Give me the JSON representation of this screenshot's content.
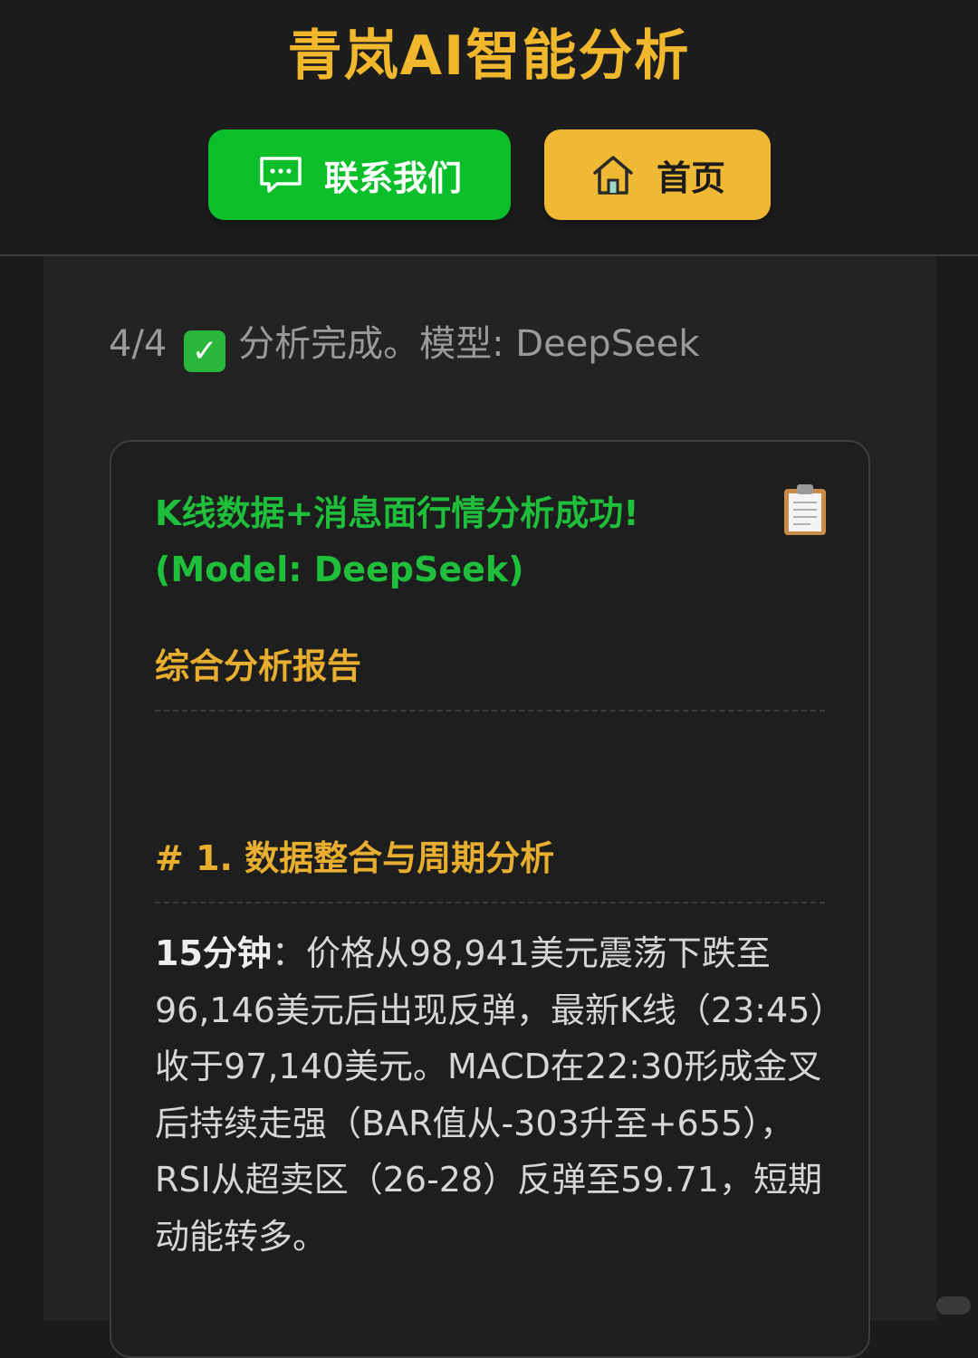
{
  "header": {
    "title": "青岚AI智能分析",
    "contact_button": "联系我们",
    "home_button": "首页",
    "contact_icon": "chat-bubble-icon",
    "home_icon": "house-icon"
  },
  "status": {
    "progress": "4/4",
    "check_glyph": "✓",
    "message": "分析完成。模型: DeepSeek"
  },
  "report": {
    "success_title": "K线数据+消息面行情分析成功! (Model: DeepSeek)",
    "clipboard_icon": "clipboard-icon",
    "report_heading": "综合分析报告",
    "section_heading": "# 1. 数据整合与周期分析",
    "body_label": "15分钟",
    "body_text": "：价格从98,941美元震荡下跌至96,146美元后出现反弹，最新K线（23:45）收于97,140美元。MACD在22:30形成金叉后持续走强（BAR值从-303升至+655），RSI从超卖区（26-28）反弹至59.71，短期动能转多。"
  },
  "colors": {
    "accent_gold": "#f1b82e",
    "accent_green": "#0bbf2a",
    "success_green": "#1fbf3c"
  }
}
